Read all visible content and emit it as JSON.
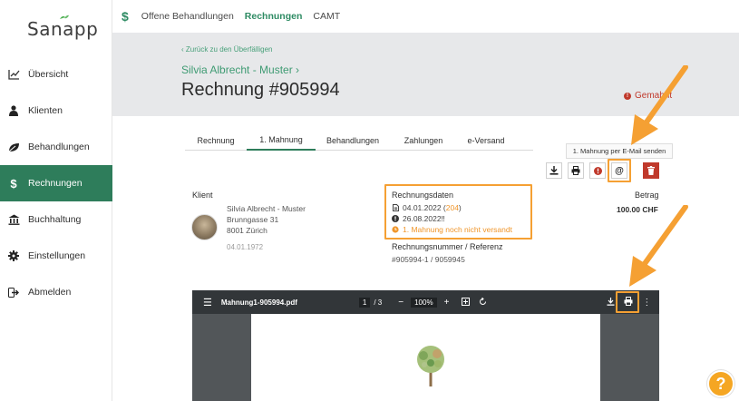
{
  "app": {
    "logo": "Sanapp"
  },
  "sidebar": {
    "items": [
      {
        "label": "Übersicht",
        "icon": "chart-line-icon"
      },
      {
        "label": "Klienten",
        "icon": "person-icon"
      },
      {
        "label": "Behandlungen",
        "icon": "leaf-icon"
      },
      {
        "label": "Rechnungen",
        "icon": "dollar-icon"
      },
      {
        "label": "Buchhaltung",
        "icon": "bank-icon"
      },
      {
        "label": "Einstellungen",
        "icon": "gear-icon"
      },
      {
        "label": "Abmelden",
        "icon": "logout-icon"
      }
    ]
  },
  "topbar": {
    "icon": "$",
    "links": [
      "Offene Behandlungen",
      "Rechnungen",
      "CAMT"
    ]
  },
  "header": {
    "back": "‹ Zurück zu den Überfälligen",
    "patient": "Silvia Albrecht - Muster ›",
    "title": "Rechnung #905994",
    "status": "Gemahnt"
  },
  "tabs": [
    "Rechnung",
    "1. Mahnung",
    "Behandlungen",
    "Zahlungen",
    "e-Versand"
  ],
  "tooltip": "1. Mahnung per E-Mail senden",
  "client": {
    "label": "Klient",
    "name": "Silvia Albrecht - Muster",
    "street": "Brunngasse 31",
    "city": "8001 Zürich",
    "dob": "04.01.1972"
  },
  "invoice_data": {
    "label": "Rechnungsdaten",
    "date_prefix": "04.01.2022 (",
    "date_days": "204",
    "date_suffix": ")",
    "due": "26.08.2022‼",
    "reminder_status": "1. Mahnung noch nicht versandt",
    "ref_label": "Rechnungsnummer / Referenz",
    "ref_value": "#905994-1 / 9059945"
  },
  "amount": {
    "label": "Betrag",
    "value": "100.00 CHF"
  },
  "pdf": {
    "filename": "Mahnung1-905994.pdf",
    "page": "1",
    "pages": "/ 3",
    "zoom": "100%"
  },
  "help": "?",
  "colors": {
    "brand": "#2e7d5b",
    "highlight": "#f5a033",
    "danger": "#c0392b"
  }
}
